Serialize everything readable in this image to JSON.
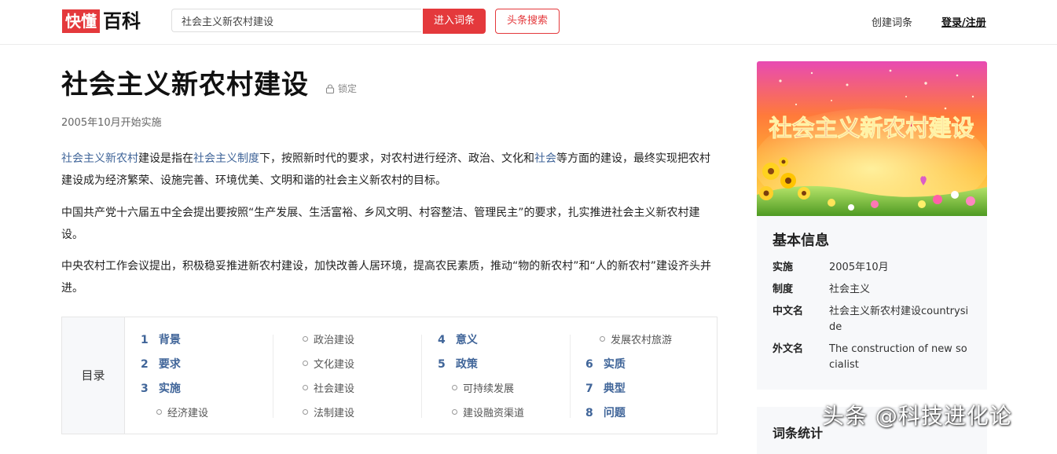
{
  "header": {
    "logo_red": "快懂",
    "logo_black": "百科",
    "search_value": "社会主义新农村建设",
    "enter_button": "进入词条",
    "toutiao_button": "头条搜索",
    "create_link": "创建词条",
    "login_link": "登录/注册"
  },
  "article": {
    "title": "社会主义新农村建设",
    "lock_label": "锁定",
    "subtitle": "2005年10月开始实施",
    "p1": {
      "link1": "社会主义新农村",
      "text1": "建设是指在",
      "link2": "社会主义制度",
      "text2": "下，按照新时代的要求，对农村进行经济、政治、文化和",
      "link3": "社会",
      "text3": "等方面的建设，最终实现把农村建设成为经济繁荣、设施完善、环境优美、文明和谐的社会主义新农村的目标。"
    },
    "p2": "中国共产党十六届五中全会提出要按照“生产发展、生活富裕、乡风文明、村容整洁、管理民主”的要求，扎实推进社会主义新农村建设。",
    "p3": "中央农村工作会议提出，积极稳妥推进新农村建设，加快改善人居环境，提高农民素质，推动“物的新农村”和“人的新农村”建设齐头并进。"
  },
  "toc": {
    "label": "目录",
    "col1": [
      {
        "num": "1",
        "text": "背景"
      },
      {
        "num": "2",
        "text": "要求"
      },
      {
        "num": "3",
        "text": "实施"
      },
      {
        "sub": "经济建设"
      }
    ],
    "col2": [
      {
        "sub": "政治建设"
      },
      {
        "sub": "文化建设"
      },
      {
        "sub": "社会建设"
      },
      {
        "sub": "法制建设"
      }
    ],
    "col3": [
      {
        "num": "4",
        "text": "意义"
      },
      {
        "num": "5",
        "text": "政策"
      },
      {
        "sub": "可持续发展"
      },
      {
        "sub": "建设融资渠道"
      }
    ],
    "col4": [
      {
        "sub": "发展农村旅游"
      },
      {
        "num": "6",
        "text": "实质"
      },
      {
        "num": "7",
        "text": "典型"
      },
      {
        "num": "8",
        "text": "问题"
      }
    ]
  },
  "sidebar": {
    "image_caption": "社会主义新农村建设",
    "info_title": "基本信息",
    "info": [
      {
        "key": "实施",
        "value": "2005年10月"
      },
      {
        "key": "制度",
        "value": "社会主义"
      },
      {
        "key": "中文名",
        "value": "社会主义新农村建设countryside"
      },
      {
        "key": "外文名",
        "value": "The construction of new socialist"
      }
    ],
    "stats_title": "词条统计"
  },
  "watermark": "头条 @科技进化论",
  "colors": {
    "brand_red": "#e4393c",
    "link_blue": "#406599",
    "panel_bg": "#f7f8fa"
  }
}
